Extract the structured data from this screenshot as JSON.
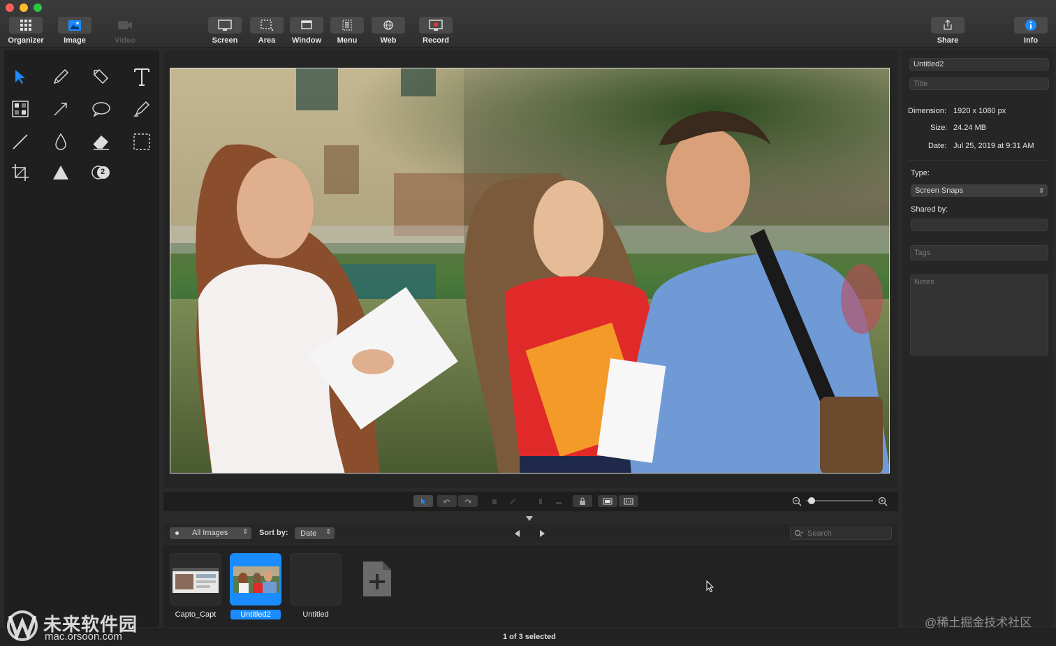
{
  "toolbar": {
    "organizer": "Organizer",
    "image": "Image",
    "video": "Video",
    "screen": "Screen",
    "area": "Area",
    "window": "Window",
    "menu": "Menu",
    "web": "Web",
    "record": "Record",
    "share": "Share",
    "info": "Info"
  },
  "tools": [
    "arrow-select",
    "pencil",
    "shape",
    "text",
    "blur-mosaic",
    "arrow-pen",
    "speech-bubble",
    "highlighter",
    "line",
    "drop-fill",
    "eraser",
    "selection-rect",
    "crop",
    "cone-spotlight",
    "step-counter"
  ],
  "step_counter_value": "2",
  "browser": {
    "filter": "All Images",
    "sort_label": "Sort by:",
    "sort_value": "Date",
    "search_placeholder": "Search",
    "thumbnails": [
      {
        "label": "Capto_Capt",
        "selected": false
      },
      {
        "label": "Untitled2",
        "selected": true
      },
      {
        "label": "Untitled",
        "selected": false
      }
    ]
  },
  "status": "1 of 3 selected",
  "inspector": {
    "name_value": "Untitled2",
    "title_placeholder": "Title",
    "dimension_label": "Dimension:",
    "dimension_value": "1920 x 1080 px",
    "size_label": "Size:",
    "size_value": "24.24 MB",
    "date_label": "Date:",
    "date_value": "Jul 25, 2019 at 9:31 AM",
    "type_label": "Type:",
    "type_value": "Screen Snaps",
    "shared_label": "Shared by:",
    "tags_placeholder": "Tags",
    "notes_placeholder": "Notes"
  },
  "watermark": {
    "logo_text": "未来软件园",
    "logo_url": "mac.orsoon.com",
    "right_text": "@稀土掘金技术社区"
  },
  "colors": {
    "accent": "#1a8cff",
    "toolbar_bg": "#353535",
    "panel_bg": "#262626"
  }
}
